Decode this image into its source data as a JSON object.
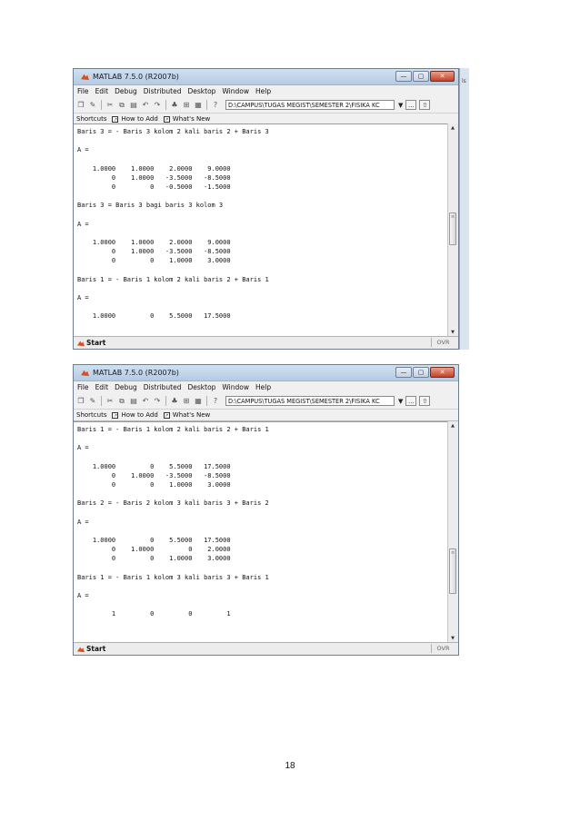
{
  "window1": {
    "title": "MATLAB 7.5.0 (R2007b)",
    "window_buttons": [
      "—",
      "▢",
      "✕"
    ],
    "menu": [
      "File",
      "Edit",
      "Debug",
      "Distributed",
      "Desktop",
      "Window",
      "Help"
    ],
    "current_directory": "D:\\CAMPUS\\TUGAS MEGIST\\SEMESTER 2\\FISIKA KC",
    "browse_label": "...",
    "shortcuts": {
      "label": "Shortcuts",
      "how_to_add": "How to Add",
      "whats_new": "What's New"
    },
    "console": "Baris 3 = - Baris 3 kolom 2 kali baris 2 + Baris 3\n\nA =\n\n    1.0000    1.0000    2.0000    9.0000\n         0    1.0000   -3.5000   -8.5000\n         0         0   -0.5000   -1.5000\n\nBaris 3 = Baris 3 bagi baris 3 kolom 3\n\nA =\n\n    1.0000    1.0000    2.0000    9.0000\n         0    1.0000   -3.5000   -8.5000\n         0         0    1.0000    3.0000\n\nBaris 1 = - Baris 1 kolom 2 kali baris 2 + Baris 1\n\nA =\n\n    1.0000         0    5.5000   17.5000",
    "start_label": "Start",
    "ovr_label": "OVR",
    "side_text": "ls"
  },
  "window2": {
    "title": "MATLAB 7.5.0 (R2007b)",
    "window_buttons": [
      "—",
      "▢",
      "✕"
    ],
    "menu": [
      "File",
      "Edit",
      "Debug",
      "Distributed",
      "Desktop",
      "Window",
      "Help"
    ],
    "current_directory": "D:\\CAMPUS\\TUGAS MEGIST\\SEMESTER 2\\FISIKA KC",
    "browse_label": "...",
    "shortcuts": {
      "label": "Shortcuts",
      "how_to_add": "How to Add",
      "whats_new": "What's New"
    },
    "console": "Baris 1 = - Baris 1 kolom 2 kali baris 2 + Baris 1\n\nA =\n\n    1.0000         0    5.5000   17.5000\n         0    1.0000   -3.5000   -8.5000\n         0         0    1.0000    3.0000\n\nBaris 2 = - Baris 2 kolom 3 kali baris 3 + Baris 2\n\nA =\n\n    1.0000         0    5.5000   17.5000\n         0    1.0000         0    2.0000\n         0         0    1.0000    3.0000\n\nBaris 1 = - Baris 1 kolom 3 kali baris 3 + Baris 1\n\nA =\n\n         1         0         0         1",
    "start_label": "Start",
    "ovr_label": "OVR"
  },
  "icons": {
    "toolbar": [
      "new-file-icon",
      "open-folder-icon",
      "cut-icon",
      "copy-icon",
      "paste-icon",
      "undo-icon",
      "redo-icon",
      "simulink-icon",
      "guide-icon",
      "profiler-icon",
      "help-icon"
    ],
    "toolbar_glyphs": [
      "❐",
      "✎",
      "✂",
      "⧉",
      "▤",
      "↶",
      "↷",
      "♣",
      "⊞",
      "▦",
      "?"
    ]
  },
  "colors": {
    "titlebar": "#bcd0e6",
    "close_button": "#c2432a",
    "console_bg": "#ffffff",
    "matlab_logo": "#d8501e"
  },
  "page_number": "18"
}
